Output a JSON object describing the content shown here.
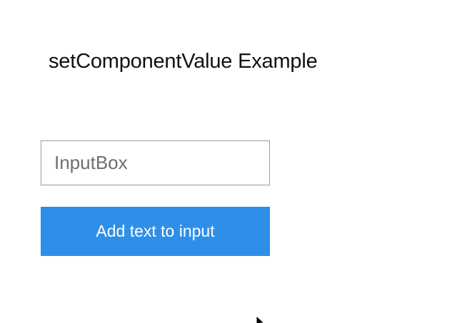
{
  "page": {
    "title": "setComponentValue Example"
  },
  "input": {
    "placeholder": "InputBox",
    "value": ""
  },
  "button": {
    "label": "Add text to input"
  },
  "colors": {
    "button_background": "#2e8fe8",
    "button_text": "#ffffff",
    "input_border": "#9a9a9a",
    "title_text": "#111111"
  },
  "icons": {
    "cursor": "mouse-pointer-icon"
  }
}
